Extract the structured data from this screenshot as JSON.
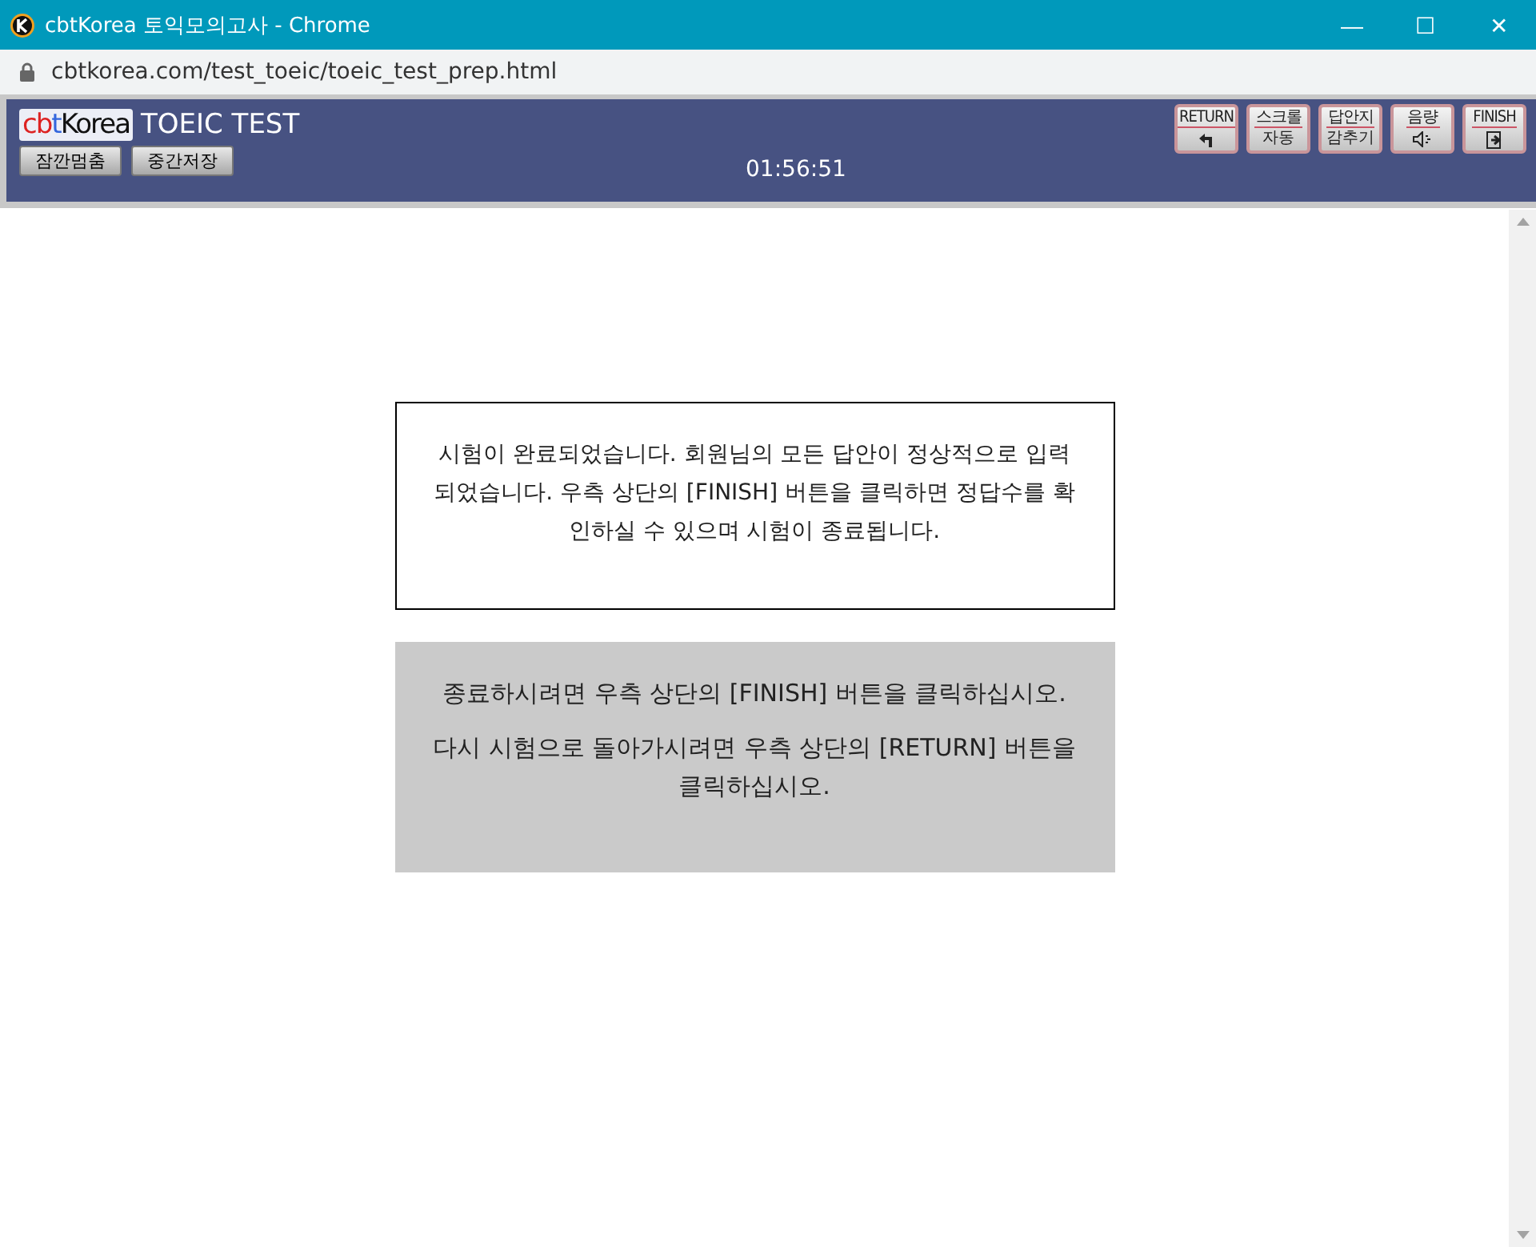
{
  "window": {
    "title": "cbtKorea 토익모의고사 - Chrome",
    "controls": [
      "—",
      "☐",
      "✕"
    ]
  },
  "address_bar": {
    "url": "cbtkorea.com/test_toeic/toeic_test_prep.html"
  },
  "header": {
    "logo": [
      {
        "text": "cb",
        "color": "#dd2222"
      },
      {
        "text": "t",
        "color": "#3366dd"
      },
      {
        "text": "Korea",
        "color": "#111111"
      }
    ],
    "title": "TOEIC TEST",
    "left_buttons": [
      "잠깐멈춤",
      "중간저장"
    ],
    "timer": "01:56:51",
    "tools": [
      {
        "label": "RETURN",
        "kind": "return"
      },
      {
        "label": "스크롤",
        "kind": "text",
        "sub": "자동"
      },
      {
        "label": "답안지",
        "kind": "text",
        "sub": "감추기"
      },
      {
        "label": "음량",
        "kind": "volume"
      },
      {
        "label": "FINISH",
        "kind": "exit"
      }
    ]
  },
  "notice": {
    "text": "시험이 완료되었습니다. 회원님의 모든 답안이 정상적으로 입력되었습니다. 우측 상단의 [FINISH] 버튼을 클릭하면 정답수를 확인하실 수 있으며 시험이 종료됩니다."
  },
  "instructions": [
    "종료하시려면 우측 상단의 [FINISH] 버튼을 클릭하십시오.",
    "다시 시험으로 돌아가시려면 우측 상단의 [RETURN] 버튼을 클릭하십시오."
  ]
}
